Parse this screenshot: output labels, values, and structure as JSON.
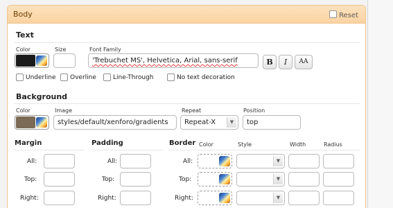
{
  "panel": {
    "title": "Body",
    "reset_label": "Reset"
  },
  "text": {
    "section": "Text",
    "color_label": "Color",
    "size_label": "Size",
    "font_family_label": "Font Family",
    "font_family_value": "'Trebuchet MS', Helvetica, Arial, sans-serif",
    "size_value": "",
    "bold_label": "B",
    "italic_label": "I",
    "case_label": "AA",
    "decorations": [
      "Underline",
      "Overline",
      "Line-Through",
      "No text decoration"
    ],
    "color_swatch": "#1a1a1a"
  },
  "background": {
    "section": "Background",
    "color_label": "Color",
    "image_label": "Image",
    "image_value": "styles/default/xenforo/gradients",
    "repeat_label": "Repeat",
    "repeat_value": "Repeat-X",
    "position_label": "Position",
    "position_value": "top",
    "color_swatch": "#7b6a55"
  },
  "margin": {
    "section": "Margin",
    "rows": [
      "All:",
      "Top:",
      "Right:"
    ]
  },
  "padding": {
    "section": "Padding",
    "rows": [
      "All:",
      "Top:",
      "Right:"
    ]
  },
  "border": {
    "section": "Border",
    "columns": {
      "color": "Color",
      "style": "Style",
      "width": "Width",
      "radius": "Radius"
    },
    "rows": [
      "All:",
      "Top:",
      "Right:"
    ]
  }
}
